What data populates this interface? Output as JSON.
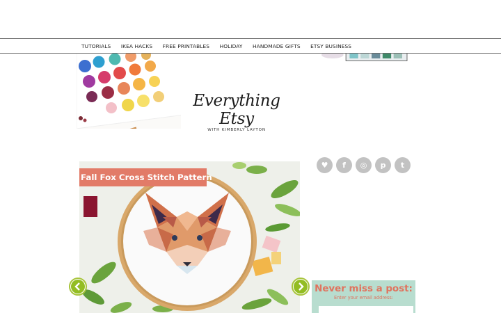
{
  "nav": {
    "items": [
      "TUTORIALS",
      "IKEA HACKS",
      "FREE PRINTABLES",
      "HOLIDAY",
      "HANDMADE GIFTS",
      "ETSY BUSINESS"
    ]
  },
  "header": {
    "logo_script": "Everything Etsy",
    "logo_sub": "WITH KIMBERLY LAYTON"
  },
  "slider": {
    "slide_title": "Fall Fox Cross Stitch Pattern",
    "prev_icon": "chevron-left-icon",
    "next_icon": "chevron-right-icon"
  },
  "social": {
    "icons": [
      "heart-icon",
      "facebook-icon",
      "instagram-icon",
      "pinterest-icon",
      "twitter-icon"
    ],
    "glyphs": [
      "♥",
      "f",
      "◎",
      "p",
      "t"
    ]
  },
  "newsletter": {
    "title": "Never miss a post:",
    "label": "Enter your email address:",
    "placeholder": ""
  },
  "colors": {
    "accent_coral": "#e27b68",
    "arrow_green": "#93bd23",
    "newsletter_bg": "#b8ddcf",
    "social_grey": "#c2c2c2"
  }
}
